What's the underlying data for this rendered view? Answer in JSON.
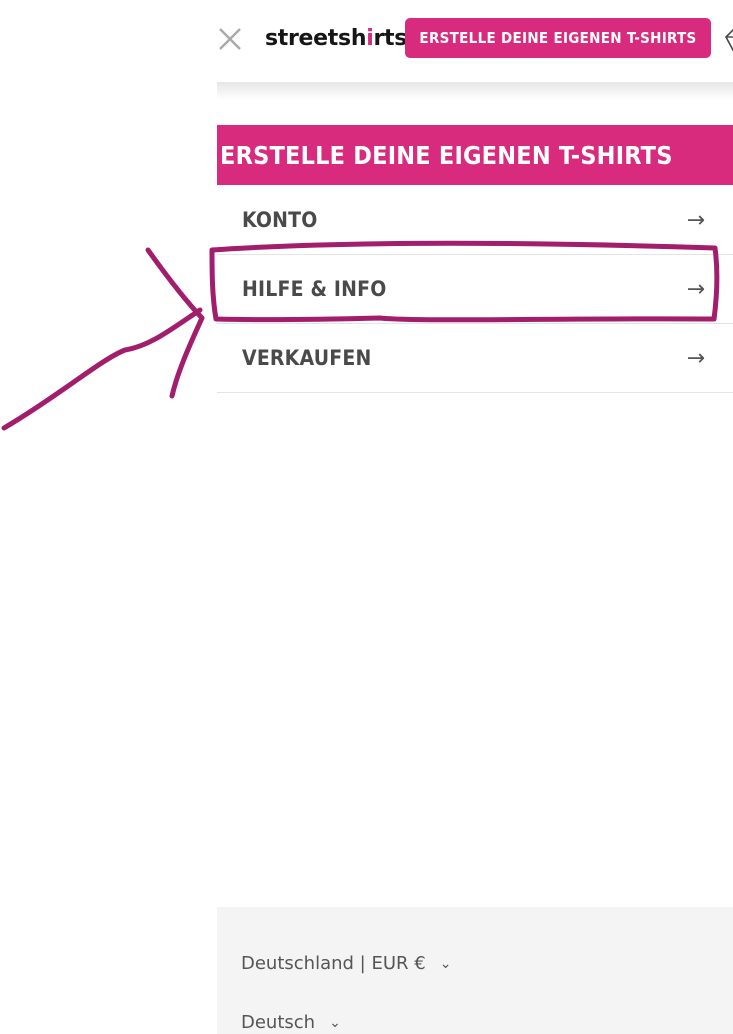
{
  "header": {
    "close_icon": "close-icon",
    "logo_text_before": "streetsh",
    "logo_mark": "i",
    "logo_text_after": "rts",
    "cta_label": "ERSTELLE DEINE EIGENEN T-SHIRTS",
    "diamond_icon": "diamond-icon"
  },
  "banner": {
    "label": "ERSTELLE DEINE EIGENEN T-SHIRTS"
  },
  "menu": {
    "items": [
      {
        "label": "KONTO",
        "arrow": "→"
      },
      {
        "label": "HILFE & INFO",
        "arrow": "→"
      },
      {
        "label": "VERKAUFEN",
        "arrow": "→"
      }
    ]
  },
  "footer": {
    "region": "Deutschland | EUR €",
    "language": "Deutsch",
    "chevron": "⌄"
  },
  "colors": {
    "brand_pink": "#d92b7e",
    "annotation_magenta": "#a21d6b"
  }
}
